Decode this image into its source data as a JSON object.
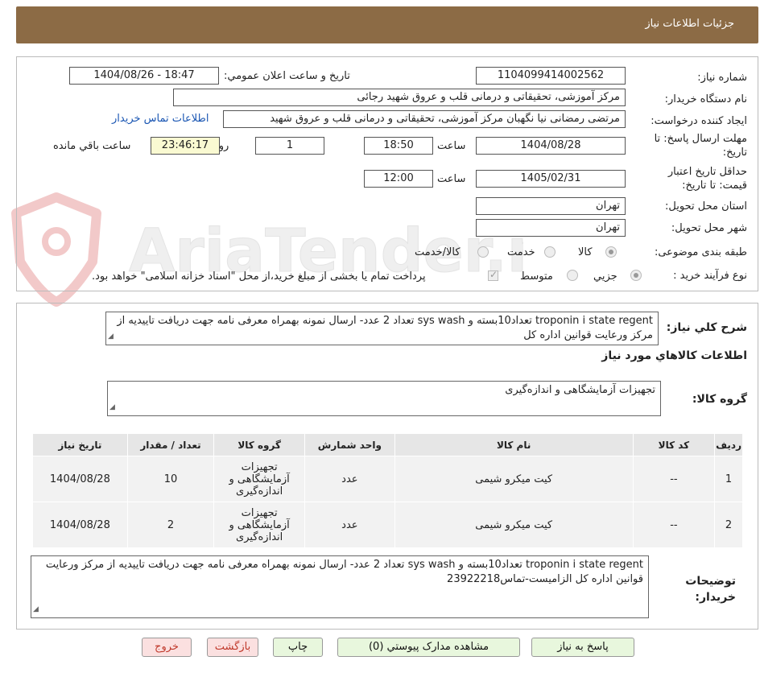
{
  "header": {
    "title": "جزئیات اطلاعات نیاز"
  },
  "watermark": {
    "text": "AriaTender.neT"
  },
  "fields": {
    "need_number_label": "شماره نیاز:",
    "need_number": "1104099414002562",
    "announce_label": "تاریخ و ساعت اعلان عمومي:",
    "announce_value": "1404/08/26 - 18:47",
    "buyer_org_label": "نام دستگاه خريدار:",
    "buyer_org": "مرکز آموزشی، تحقیقاتی و درمانی قلب و عروق شهید رجائی",
    "requester_label": "ايجاد کننده درخواست:",
    "requester": "مرتضی رمضانی نیا نگهبان مرکز آموزشی، تحقیقاتی و درمانی قلب و عروق شهید",
    "buyer_contact_link": "اطلاعات تماس خريدار",
    "deadline_label": "مهلت ارسال پاسخ: تا تاريخ:",
    "deadline_date": "1404/08/28",
    "time_label": "ساعت",
    "deadline_time": "18:50",
    "days_value": "1",
    "days_label": "روز و",
    "remaining_value": "23:46:17",
    "remaining_label": "ساعت باقي مانده",
    "validity_label": "حداقل تاريخ اعتبار قيمت: تا تاريخ:",
    "validity_date": "1405/02/31",
    "validity_time": "12:00",
    "province_label": "استان محل تحويل:",
    "province": "تهران",
    "city_label": "شهر محل تحويل:",
    "city": "تهران",
    "category_label": "طبقه بندی موضوعی:",
    "category_options": [
      "کالا",
      "خدمت",
      "کالا/خدمت"
    ],
    "process_label": "نوع فرآیند خرید :",
    "process_options": [
      "جزیي",
      "متوسط"
    ],
    "payment_note": "پرداخت تمام یا بخشی از مبلغ خرید،از محل \"اسناد خزانه اسلامی\" خواهد بود."
  },
  "description": {
    "label": "شرح کلي نياز:",
    "text": "troponin i state regent تعداد10بسته و  sys wash  تعداد 2 عدد- ارسال نمونه بهمراه معرفی نامه جهت دریافت تاییدیه از مرکز ورعایت قوانین اداره کل"
  },
  "goods": {
    "section_title": "اطلاعات کالاهاي مورد نياز",
    "group_label": "گروه کالا:",
    "group_value": "تجهیزات آزمایشگاهی و اندازه‌گیری"
  },
  "table": {
    "headers": [
      "رديف",
      "کد کالا",
      "نام کالا",
      "واحد شمارش",
      "گروه کالا",
      "تعداد / مقدار",
      "تاريخ نياز"
    ],
    "rows": [
      [
        "1",
        "--",
        "کیت میکرو شیمی",
        "عدد",
        "تجهیزات آزمایشگاهی و اندازه‌گیری",
        "10",
        "1404/08/28"
      ],
      [
        "2",
        "--",
        "کیت میکرو شیمی",
        "عدد",
        "تجهیزات آزمایشگاهی و اندازه‌گیری",
        "2",
        "1404/08/28"
      ]
    ]
  },
  "buyer_notes": {
    "label": "توضيحات خريدار:",
    "text": "troponin i state regent تعداد10بسته و  sys wash  تعداد 2 عدد- ارسال نمونه بهمراه معرفی نامه جهت دریافت تاییدیه از مرکز ورعایت قوانین اداره کل الزامیست-تماس23922218"
  },
  "buttons": {
    "reply": "پاسخ به نياز",
    "attachments": "مشاهده مدارک پيوستي (0)",
    "print": "چاپ",
    "back": "بازگشت",
    "exit": "خروج"
  }
}
